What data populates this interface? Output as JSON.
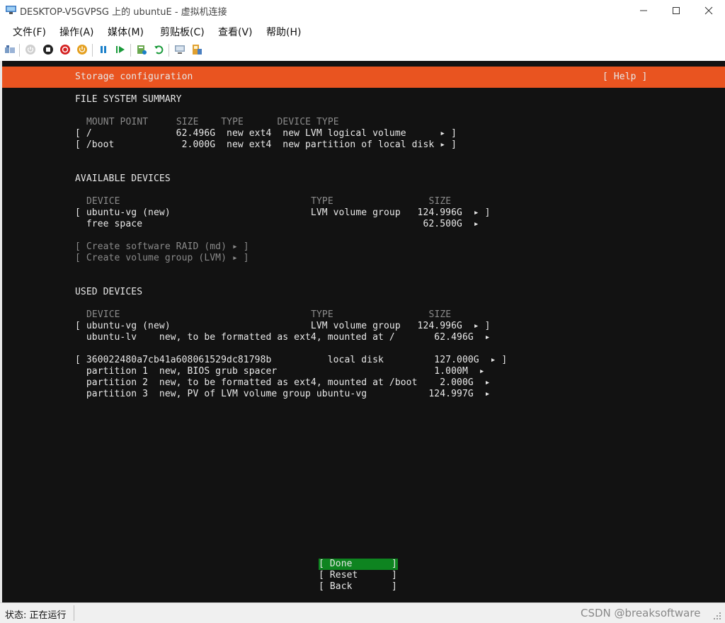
{
  "window": {
    "title": "DESKTOP-V5GVPSG 上的 ubuntuE - 虚拟机连接"
  },
  "menu": [
    "文件(F)",
    "操作(A)",
    "媒体(M)",
    "剪贴板(C)",
    "查看(V)",
    "帮助(H)"
  ],
  "header": {
    "title": "Storage configuration",
    "help": "[ Help ]"
  },
  "fs_summary": {
    "heading": "FILE SYSTEM SUMMARY",
    "columns": "MOUNT POINT     SIZE    TYPE      DEVICE TYPE",
    "rows": [
      "[ /               62.496G  new ext4  new LVM logical volume      ▸ ]",
      "[ /boot            2.000G  new ext4  new partition of local disk ▸ ]"
    ]
  },
  "available": {
    "heading": "AVAILABLE DEVICES",
    "columns": "DEVICE                                  TYPE                 SIZE",
    "rows": [
      "[ ubuntu-vg (new)                         LVM volume group   124.996G  ▸ ]",
      "  free space                                                  62.500G  ▸"
    ],
    "actions": [
      "[ Create software RAID (md) ▸ ]",
      "[ Create volume group (LVM) ▸ ]"
    ]
  },
  "used": {
    "heading": "USED DEVICES",
    "columns": "DEVICE                                  TYPE                 SIZE",
    "rows": [
      "[ ubuntu-vg (new)                         LVM volume group   124.996G  ▸ ]",
      "  ubuntu-lv    new, to be formatted as ext4, mounted at /       62.496G  ▸",
      "[ 360022480a7cb41a608061529dc81798b          local disk         127.000G  ▸ ]",
      "  partition 1  new, BIOS grub spacer                            1.000M  ▸",
      "  partition 2  new, to be formatted as ext4, mounted at /boot    2.000G  ▸",
      "  partition 3  new, PV of LVM volume group ubuntu-vg           124.997G  ▸"
    ]
  },
  "buttons": {
    "done": "[ Done       ]",
    "reset": "[ Reset      ]",
    "back": "[ Back       ]"
  },
  "status": {
    "text": "状态: 正在运行",
    "watermark": "CSDN @breaksoftware"
  },
  "colors": {
    "accent": "#e95420",
    "done_button": "#0e8420",
    "terminal_bg": "#121212"
  }
}
